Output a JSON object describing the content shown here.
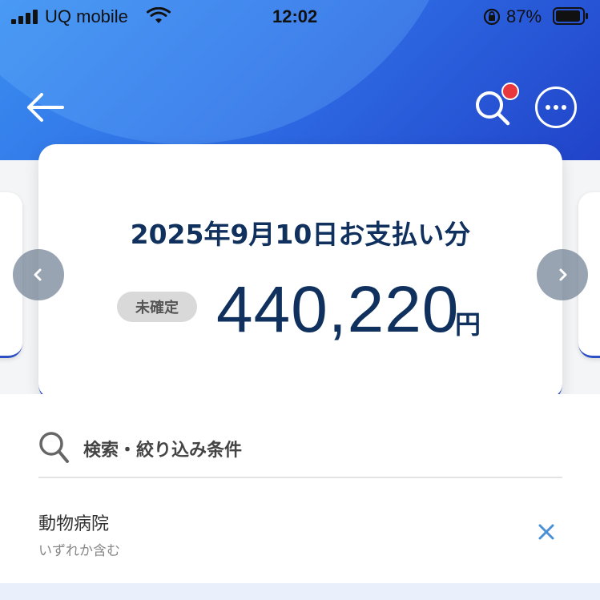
{
  "status_bar": {
    "carrier": "UQ mobile",
    "time": "12:02",
    "battery_percent": "87%"
  },
  "header": {
    "back_icon": "arrow-left-icon",
    "search_icon": "search-icon",
    "more_icon": "more-horizontal-icon",
    "has_notification": true
  },
  "payment_card": {
    "title": "2025年9月10日お支払い分",
    "status": "未確定",
    "amount": "440,220",
    "currency": "円"
  },
  "search_section": {
    "label": "検索・絞り込み条件"
  },
  "filter": {
    "title": "動物病院",
    "subtitle": "いずれか含む"
  },
  "colors": {
    "header_start": "#3a8ef0",
    "header_end": "#2143c9",
    "navy": "#10305e",
    "accent_blue": "#1f43c0",
    "remove_x": "#4a90d9",
    "notification": "#e8383d"
  }
}
